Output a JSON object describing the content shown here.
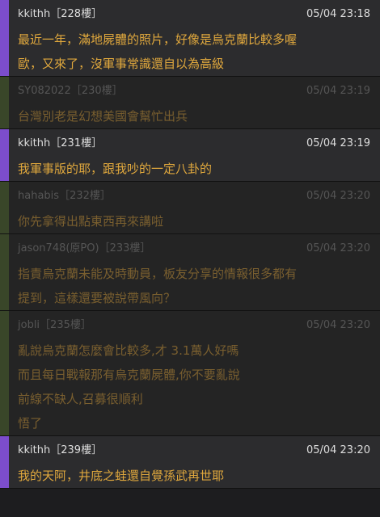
{
  "posts": [
    {
      "author": "kkithh",
      "floor": "［228樓］",
      "time": "05/04 23:18",
      "dim": false,
      "lines": [
        "最近一年，滿地屍體的照片，好像是烏克蘭比較多喔",
        "歐，又來了，沒軍事常識還自以為高級"
      ]
    },
    {
      "author": "SY082022",
      "floor": "［230樓］",
      "time": "05/04 23:19",
      "dim": true,
      "lines": [
        "台灣別老是幻想美國會幫忙出兵"
      ]
    },
    {
      "author": "kkithh",
      "floor": "［231樓］",
      "time": "05/04 23:19",
      "dim": false,
      "lines": [
        "我軍事版的耶，跟我吵的一定八卦的"
      ]
    },
    {
      "author": "hahabis",
      "floor": "［232樓］",
      "time": "05/04 23:20",
      "dim": true,
      "lines": [
        "你先拿得出點東西再來講啦"
      ]
    },
    {
      "author": "jason748",
      "floor": "(原PO)［233樓］",
      "time": "05/04 23:20",
      "dim": true,
      "lines": [
        "指責烏克蘭未能及時動員，板友分享的情報很多都有",
        "提到，這樣還要被說帶風向？"
      ]
    },
    {
      "author": "jobli",
      "floor": "［235樓］",
      "time": "05/04 23:20",
      "dim": true,
      "lines": [
        "亂說烏克蘭怎麼會比較多,才 3.1萬人好嗎",
        "而且每日戰報那有烏克蘭屍體,你不要亂說",
        "前線不缺人,召募很順利",
        "悟了"
      ]
    },
    {
      "author": "kkithh",
      "floor": "［239樓］",
      "time": "05/04 23:20",
      "dim": false,
      "lines": [
        "我的天阿，井底之蛙還自覺孫武再世耶"
      ]
    }
  ]
}
